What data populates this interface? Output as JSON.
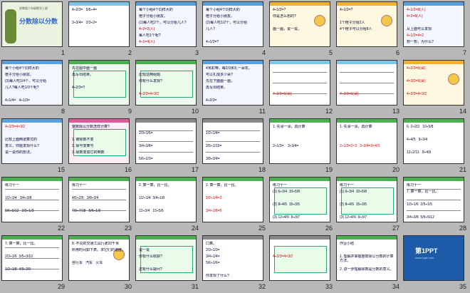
{
  "slides": [
    {
      "n": "1",
      "kind": "cover",
      "title": "分数除以分数",
      "sub": "苏教版六年级数学上册",
      "bg": "#eaf3e0",
      "bar": ""
    },
    {
      "n": "2",
      "kind": "text",
      "lines": [
        "4÷2/3=   5/6÷4=",
        "",
        "3÷3/4=   2/3÷2="
      ],
      "bg": "#ffffff",
      "bar": "#7cc4e8"
    },
    {
      "n": "3",
      "kind": "text",
      "lines": [
        "每个小组4个同样大的",
        "橙子分给小朋友。",
        "(1)每人吃2个，可以分给几人?",
        "4÷2=2(人)",
        "每人吃1个呢?",
        "4÷1=4(人)"
      ],
      "bg": "#f2f7ff",
      "bar": "#5aa0e0"
    },
    {
      "n": "4",
      "kind": "text",
      "lines": [
        "每个小组4个同样大的",
        "橙子分给小朋友。",
        "(2)每人吃1/2个，可以分给",
        "几人?",
        "",
        "4÷1/2=?"
      ],
      "bg": "#f2f7ff",
      "bar": "#5aa0e0"
    },
    {
      "n": "5",
      "kind": "pic",
      "lines": [
        "4÷1/2=?",
        "你是怎么想的?",
        "",
        "画一画，说一说。"
      ],
      "bg": "#fff8e0",
      "bar": "#f0b030"
    },
    {
      "n": "6",
      "kind": "pic",
      "lines": [
        "4÷1/2=?",
        "",
        "1个橙子分给2人",
        "4个橙子可以分给8人"
      ],
      "bg": "#fff8e0",
      "bar": "#f0b030"
    },
    {
      "n": "7",
      "kind": "text",
      "lines": [
        "4÷1/2=8(人)",
        "4×2=8(人)",
        "",
        "从上面可以发现",
        "4÷1/2=4×2",
        "想一想，为什么?"
      ],
      "bg": "#f2f7ff",
      "bar": "#5aa0e0"
    },
    {
      "n": "8",
      "kind": "text",
      "lines": [
        "每个小组4个同样大的",
        "橙子分给小朋友。",
        "(3)每人吃1/4个，可以分给",
        "几人?每人吃1/3个呢?",
        "",
        "4÷1/4=   4÷1/3="
      ],
      "bg": "#f2f7ff",
      "bar": "#5aa0e0"
    },
    {
      "n": "9",
      "kind": "box",
      "lines": [
        "先在图中画一画",
        "再写出结果。",
        "",
        "4÷2/3=?"
      ],
      "bg": "#eef9ee",
      "bar": "#4cb050"
    },
    {
      "n": "10",
      "kind": "box",
      "lines": [
        "",
        "比较这两组题",
        "你有什么发现?",
        "",
        "4÷2/3=4×3/2"
      ],
      "bg": "#eef9ee",
      "bar": "#4cb050"
    },
    {
      "n": "11",
      "kind": "text",
      "lines": [
        "4米彩带，每2/3米扎一朵花，",
        "可以扎成多少朵?",
        "先在下面画一画，",
        "再写出结果。",
        "",
        "4÷2/3="
      ],
      "bg": "#f2f7ff",
      "bar": "#5aa0e0"
    },
    {
      "n": "12",
      "kind": "strip",
      "lines": [
        "",
        "",
        "",
        "",
        "4÷2/3=6(朵)"
      ],
      "bg": "#ffffff",
      "bar": "#7cc4e8"
    },
    {
      "n": "13",
      "kind": "strip",
      "lines": [
        "",
        "",
        "",
        "",
        "4÷2/3=6(朵)"
      ],
      "bg": "#ffffff",
      "bar": "#7cc4e8"
    },
    {
      "n": "14",
      "kind": "pic",
      "lines": [
        "4÷2/3=6(朵)",
        "",
        "4×3/2=6(朵)",
        "",
        "4÷2/3=4×3/2"
      ],
      "bg": "#fff8e0",
      "bar": "#f0b030"
    },
    {
      "n": "15",
      "kind": "text",
      "lines": [
        "4÷2/3=4×3/2",
        "",
        "比较上面两道算式的",
        "意义，你能发现什么?",
        "说一说你的想法。"
      ],
      "bg": "#f2f7ff",
      "bar": "#5aa0e0"
    },
    {
      "n": "16",
      "kind": "box",
      "lines": [
        "整数除以分数怎样计算?",
        "",
        "1. 被除数不变",
        "2. 除号变乘号",
        "3. 除数变成它的倒数"
      ],
      "bg": "#fdeef5",
      "bar": "#e05a9a"
    },
    {
      "n": "17",
      "kind": "strip",
      "lines": [
        "",
        "2/3÷1/6=",
        "",
        "3/4÷3/8=",
        "",
        "5/6÷2/3="
      ],
      "bg": "#ffffff",
      "bar": "#888888"
    },
    {
      "n": "18",
      "kind": "strip",
      "lines": [
        "",
        "1/2÷1/4=",
        "",
        "2/5÷1/10=",
        "",
        "3/8÷3/4="
      ],
      "bg": "#ffffff",
      "bar": "#888888"
    },
    {
      "n": "19",
      "kind": "text",
      "lines": [
        "1. 先涂一涂，再计算",
        "",
        "",
        "2÷1/3=    3÷3/4="
      ],
      "bg": "#ffffff",
      "bar": "#4cb050"
    },
    {
      "n": "20",
      "kind": "text",
      "lines": [
        "1. 先涂一涂，再计算",
        "",
        "",
        "2÷1/3=2×3   3÷3/4=3×4/3"
      ],
      "bg": "#ffffff",
      "bar": "#4cb050"
    },
    {
      "n": "21",
      "kind": "text",
      "lines": [
        "6. 2÷2/3   10÷5/8",
        "",
        "4÷4/5   9÷3/4",
        "",
        "12÷2/11   8÷4/9"
      ],
      "bg": "#ffffff",
      "bar": "#4cb050"
    },
    {
      "n": "22",
      "kind": "strip",
      "lines": [
        "练习十一",
        "",
        "1/2÷1/4   3/4÷3/8",
        "",
        "5/6÷5/12   2/3÷1/3"
      ],
      "bg": "#ffffff",
      "bar": "#4cb050"
    },
    {
      "n": "23",
      "kind": "strip",
      "lines": [
        "练习十一",
        "",
        "4/5÷2/5   3/8÷3/4",
        "",
        "7/9÷7/18   5/6÷1/6"
      ],
      "bg": "#ffffff",
      "bar": "#4cb050"
    },
    {
      "n": "24",
      "kind": "text",
      "lines": [
        "2. 算一算，比一比。",
        "",
        "1/2÷1/4  3/4÷1/8",
        "",
        "12÷3/4   15÷5/6"
      ],
      "bg": "#ffffff",
      "bar": "#4cb050"
    },
    {
      "n": "25",
      "kind": "text",
      "lines": [
        "2. 算一算，比一比。",
        "",
        "1/2÷1/4=2",
        "",
        "3/4÷1/8=6"
      ],
      "bg": "#ffffff",
      "bar": "#4cb050"
    },
    {
      "n": "26",
      "kind": "box",
      "lines": [
        "练习十一",
        "(1) 6÷3/4  10÷5/8",
        "",
        "(2) 8÷4/5  15÷3/5",
        "",
        "(3) 12÷4/9  9÷3/7"
      ],
      "bg": "#ffffff",
      "bar": "#4cb050"
    },
    {
      "n": "27",
      "kind": "box",
      "lines": [
        "练习十一",
        "(1) 6÷3/4  10÷5/8",
        "",
        "(2) 8÷4/5  15÷3/5",
        "",
        "(3) 12÷4/9  9÷3/7"
      ],
      "bg": "#ffffff",
      "bar": "#4cb050"
    },
    {
      "n": "28",
      "kind": "strip",
      "lines": [
        "练习十一",
        "7. 算一算，比一比。",
        "",
        "1/3÷1/6  2/5÷1/5",
        "",
        "3/4÷3/8  5/6÷5/12"
      ],
      "bg": "#ffffff",
      "bar": "#4cb050"
    },
    {
      "n": "29",
      "kind": "strip",
      "lines": [
        "7. 算一算，比一比。",
        "",
        "2/3÷1/6  3/5÷3/10",
        "",
        "1/2÷1/8  4/9÷2/9"
      ],
      "bg": "#ffffff",
      "bar": "#4cb050"
    },
    {
      "n": "30",
      "kind": "pic",
      "lines": [
        "8. 不同的交通工具行驶20千米",
        "所用时间如下表。求它们的速度。",
        "",
        "自行车   汽车   火车"
      ],
      "bg": "#ffffff",
      "bar": "#4cb050"
    },
    {
      "n": "31",
      "kind": "box",
      "lines": [
        "",
        "说一说",
        "你有什么收获?",
        "",
        "还有什么疑问?"
      ],
      "bg": "#eef9ee",
      "bar": "#4cb050"
    },
    {
      "n": "32",
      "kind": "text",
      "lines": [
        "口算。",
        "2/3÷1/3=",
        "3/4÷1/4=",
        "5/6÷1/6=",
        "",
        "你发现了什么?"
      ],
      "bg": "#ffffff",
      "bar": "#888888"
    },
    {
      "n": "33",
      "kind": "box",
      "lines": [
        "",
        "",
        "4÷2/3=4×3/2",
        "",
        ""
      ],
      "bg": "#ffffff",
      "bar": "#888888"
    },
    {
      "n": "34",
      "kind": "text",
      "lines": [
        "作业小结",
        "",
        "1. 理解并掌握整数除以分数的计算方法。",
        "",
        "2. 进一步理解除数是分数的意义。"
      ],
      "bg": "#ffffff",
      "bar": "#4cb050"
    },
    {
      "n": "35",
      "kind": "logo",
      "title": "第1PPT",
      "sub": "www.1ppt.com",
      "bg": "#1d5aa8",
      "bar": ""
    }
  ]
}
